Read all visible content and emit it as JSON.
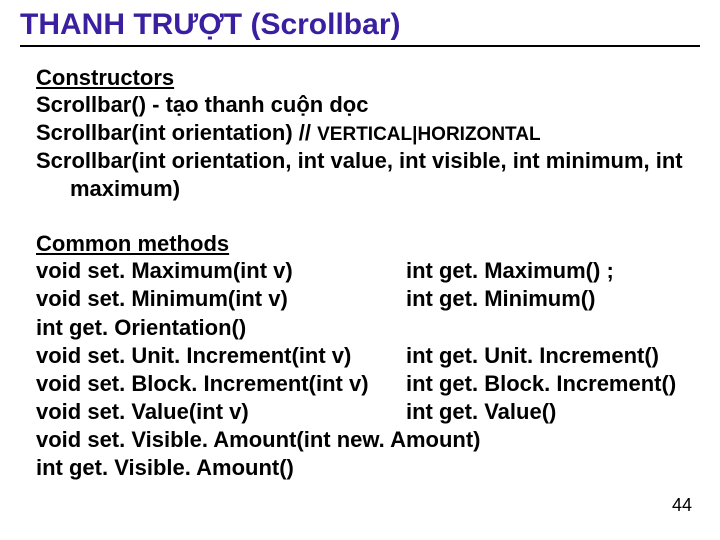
{
  "title": "THANH TRƯỢT (Scrollbar)",
  "constructors": {
    "heading": "Constructors",
    "l1": "Scrollbar() - tạo thanh cuộn dọc",
    "l2a": "Scrollbar(int orientation)  // ",
    "l2b": "VERTICAL|HORIZONTAL",
    "l3a": "Scrollbar(int orientation, int value, int visible, int minimum, int",
    "l3b": "maximum)"
  },
  "methods": {
    "heading": "Common methods",
    "rows": [
      {
        "left": "void set. Maximum(int v)",
        "right": "int get. Maximum() ;"
      },
      {
        "left": "void set. Minimum(int v)",
        "right": "int get. Minimum()"
      },
      {
        "left": "int   get. Orientation()",
        "right": ""
      },
      {
        "left": "void  set. Unit. Increment(int v)",
        "right": "int get. Unit. Increment()"
      },
      {
        "left": "void  set. Block. Increment(int v)",
        "right": "int get. Block. Increment()"
      },
      {
        "left": "void  set. Value(int v)",
        "right": " int  get. Value()"
      },
      {
        "left": "void  set. Visible. Amount(int new. Amount)",
        "right": ""
      },
      {
        "left": "int    get. Visible. Amount()",
        "right": ""
      }
    ]
  },
  "page_number": "44"
}
